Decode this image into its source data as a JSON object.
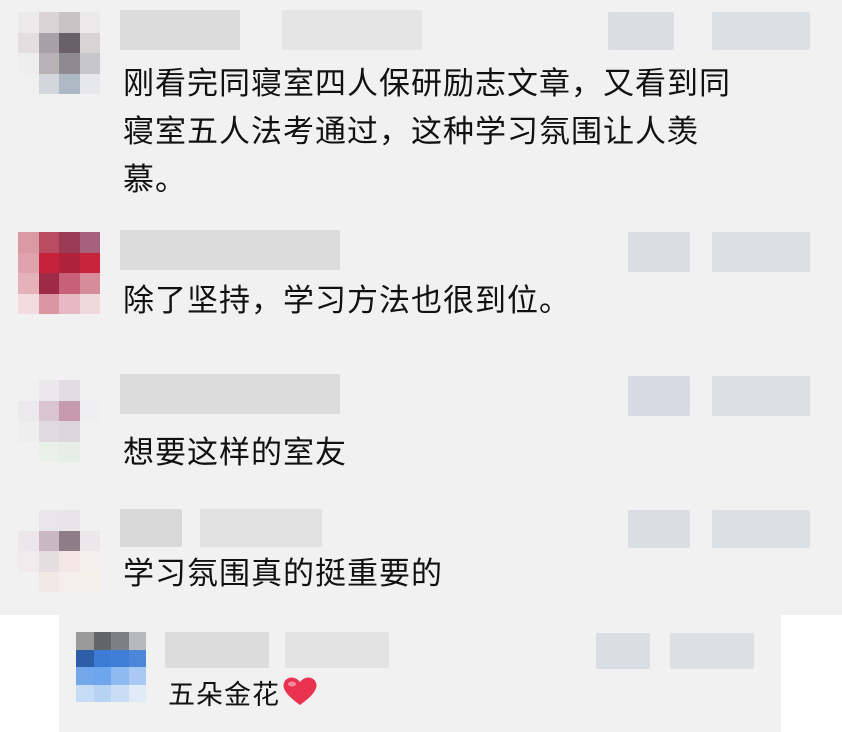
{
  "comments": [
    {
      "id": 1,
      "text_lines": [
        "刚看完同寝室四人保研励志文章，又看到同",
        "寝室五人法考通过，这种学习氛围让人羡",
        "慕。"
      ],
      "username": "",
      "timestamp": "",
      "likes": ""
    },
    {
      "id": 2,
      "text": "除了坚持，学习方法也很到位。",
      "username": "",
      "timestamp": "",
      "likes": ""
    },
    {
      "id": 3,
      "text": "想要这样的室友",
      "username": "",
      "timestamp": "",
      "likes": ""
    },
    {
      "id": 4,
      "text": "学习氛围真的挺重要的",
      "username": "",
      "timestamp": "",
      "likes": ""
    },
    {
      "id": 5,
      "text": "五朵金花",
      "emoji": "heart-icon",
      "username": "",
      "timestamp": "",
      "likes": ""
    }
  ],
  "colors": {
    "panel": "#f1f1f1",
    "text": "#111111",
    "heart": "#e8324f"
  }
}
